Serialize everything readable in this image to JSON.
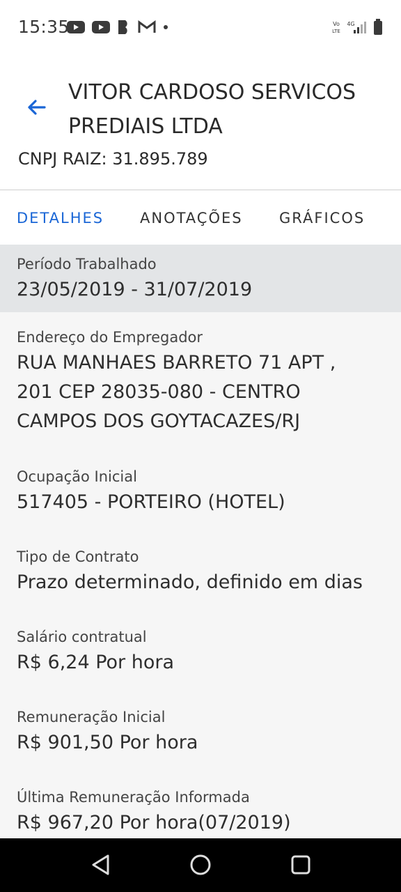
{
  "status_bar": {
    "time": "15:35",
    "left_icons": [
      "youtube-icon",
      "youtube-icon",
      "b-app-icon",
      "gmail-icon",
      "dot-icon"
    ],
    "right_icons": [
      "volte-lte-icon",
      "4g-icon",
      "signal-icon",
      "battery-icon"
    ],
    "volte_label": "Vo LTE",
    "network_label": "4G"
  },
  "header": {
    "title_line1": "VITOR CARDOSO SERVICOS",
    "title_line2": "PREDIAIS LTDA",
    "cnpj": "CNPJ RAIZ: 31.895.789"
  },
  "tabs": [
    {
      "label": "DETALHES",
      "active": true
    },
    {
      "label": "ANOTAÇÕES",
      "active": false
    },
    {
      "label": "GRÁFICOS",
      "active": false
    }
  ],
  "details": [
    {
      "label": "Período Trabalhado",
      "value": "23/05/2019 - 31/07/2019"
    },
    {
      "label": "Endereço do Empregador",
      "value_lines": [
        "RUA MANHAES BARRETO 71 APT  ,",
        "201 CEP 28035-080 - CENTRO",
        "CAMPOS DOS GOYTACAZES/RJ"
      ]
    },
    {
      "label": "Ocupação Inicial",
      "value": "517405 - PORTEIRO (HOTEL)"
    },
    {
      "label": "Tipo de Contrato",
      "value": "Prazo determinado, definido em dias"
    },
    {
      "label": "Salário contratual",
      "value": "R$ 6,24 Por hora"
    },
    {
      "label": "Remuneração Inicial",
      "value": "R$ 901,50 Por hora"
    },
    {
      "label": "Última Remuneração Informada",
      "value": "R$ 967,20 Por hora(07/2019)"
    }
  ],
  "colors": {
    "accent": "#1a66d6",
    "highlight_row": "#e3e5e7",
    "content_bg": "#f6f6f6",
    "navbar": "#000000"
  },
  "navbar": [
    "back-triangle-icon",
    "home-circle-icon",
    "recents-square-icon"
  ]
}
